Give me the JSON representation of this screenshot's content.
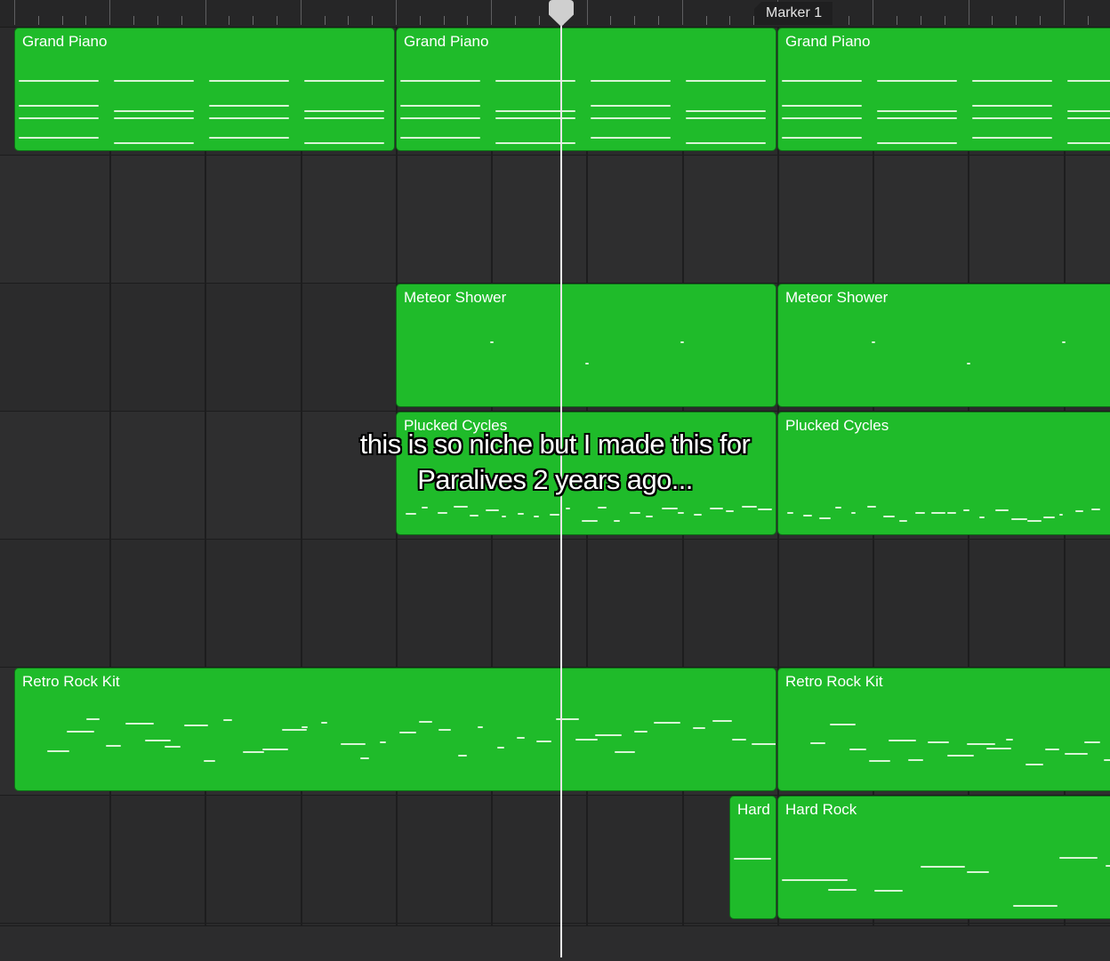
{
  "ruler": {
    "marker_label": "Marker 1"
  },
  "tracks": [
    {
      "regions": [
        {
          "label": "Grand Piano"
        },
        {
          "label": "Grand Piano"
        },
        {
          "label": "Grand Piano"
        }
      ]
    },
    {
      "regions": []
    },
    {
      "regions": [
        {
          "label": "Meteor Shower"
        },
        {
          "label": "Meteor Shower"
        }
      ]
    },
    {
      "regions": [
        {
          "label": "Plucked Cycles"
        },
        {
          "label": "Plucked Cycles"
        }
      ]
    },
    {
      "regions": []
    },
    {
      "regions": [
        {
          "label": "Retro Rock Kit"
        },
        {
          "label": "Retro Rock Kit"
        }
      ]
    },
    {
      "regions": [
        {
          "label": "Hard"
        },
        {
          "label": "Hard Rock"
        }
      ]
    }
  ],
  "caption": {
    "text": "this is so niche but I made this for Paralives 2 years ago..."
  },
  "colors": {
    "region_green": "#1fbb2a",
    "background": "#2a2a2b",
    "playhead": "#e8e8e8"
  }
}
